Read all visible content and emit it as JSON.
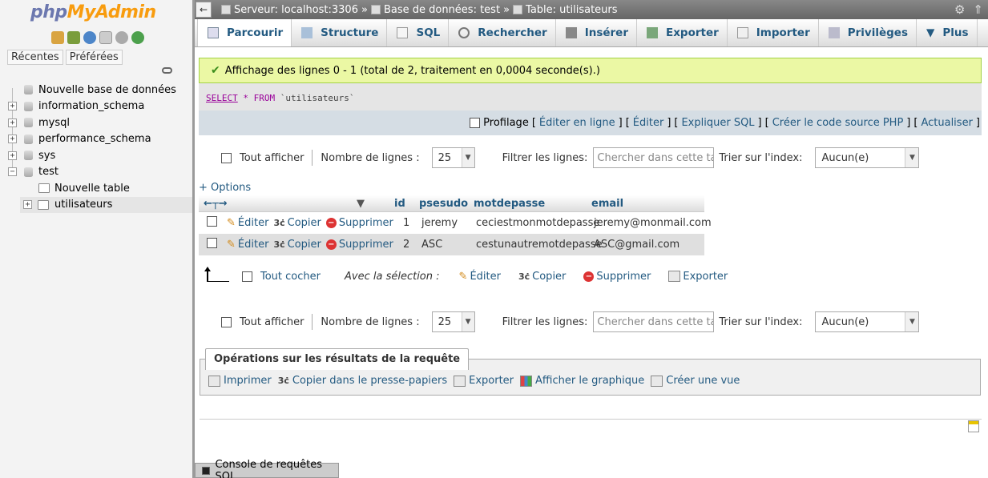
{
  "left": {
    "logo_part1": "php",
    "logo_part2": "MyAdmin",
    "tabs": [
      "Récentes",
      "Préférées"
    ],
    "tree": [
      {
        "label": "Nouvelle base de données",
        "expander": ""
      },
      {
        "label": "information_schema",
        "expander": "+"
      },
      {
        "label": "mysql",
        "expander": "+"
      },
      {
        "label": "performance_schema",
        "expander": "+"
      },
      {
        "label": "sys",
        "expander": "+"
      },
      {
        "label": "test",
        "expander": "−"
      },
      {
        "label": "Nouvelle table",
        "expander": ""
      },
      {
        "label": "utilisateurs",
        "expander": "+"
      }
    ]
  },
  "topbar": {
    "back": "←",
    "server": "Serveur: localhost:3306",
    "sep": "»",
    "database": "Base de données: test",
    "table": "Table: utilisateurs"
  },
  "tabs": [
    "Parcourir",
    "Structure",
    "SQL",
    "Rechercher",
    "Insérer",
    "Exporter",
    "Importer",
    "Privilèges",
    "Plus"
  ],
  "success_message": "Affichage des lignes 0 - 1 (total de 2, traitement en 0,0004 seconde(s).)",
  "sql": {
    "select": "SELECT",
    "star": "*",
    "from": "FROM",
    "table": "`utilisateurs`"
  },
  "sql_tools": {
    "profilage": "Profilage",
    "links": [
      "Éditer en ligne",
      "Éditer",
      "Expliquer SQL",
      "Créer le code source PHP",
      "Actualiser"
    ]
  },
  "nav": {
    "show_all": "Tout afficher",
    "rows_label": "Nombre de lignes :",
    "rows_value": "25",
    "filter_label": "Filtrer les lignes:",
    "filter_placeholder": "Chercher dans cette table",
    "sort_label": "Trier sur l'index:",
    "sort_value": "Aucun(e)"
  },
  "options_label": "+ Options",
  "table": {
    "headers": [
      "id",
      "psesudo",
      "motdepasse",
      "email"
    ],
    "actions": {
      "edit": "Éditer",
      "copy": "Copier",
      "delete": "Supprimer"
    },
    "rows": [
      {
        "id": "1",
        "pseudo": "jeremy",
        "motdepasse": "ceciestmonmotdepasse",
        "email": "jeremy@monmail.com"
      },
      {
        "id": "2",
        "pseudo": "ASC",
        "motdepasse": "cestunautremotdepasse",
        "email": "ASC@gmail.com"
      }
    ]
  },
  "bulk": {
    "check_all": "Tout cocher",
    "with_selection": "Avec la sélection :",
    "edit": "Éditer",
    "copy": "Copier",
    "delete": "Supprimer",
    "export": "Exporter"
  },
  "ops": {
    "title": "Opérations sur les résultats de la requête",
    "links": [
      "Imprimer",
      "Copier dans le presse-papiers",
      "Exporter",
      "Afficher le graphique",
      "Créer une vue"
    ]
  },
  "console": "Console de requêtes SQL"
}
